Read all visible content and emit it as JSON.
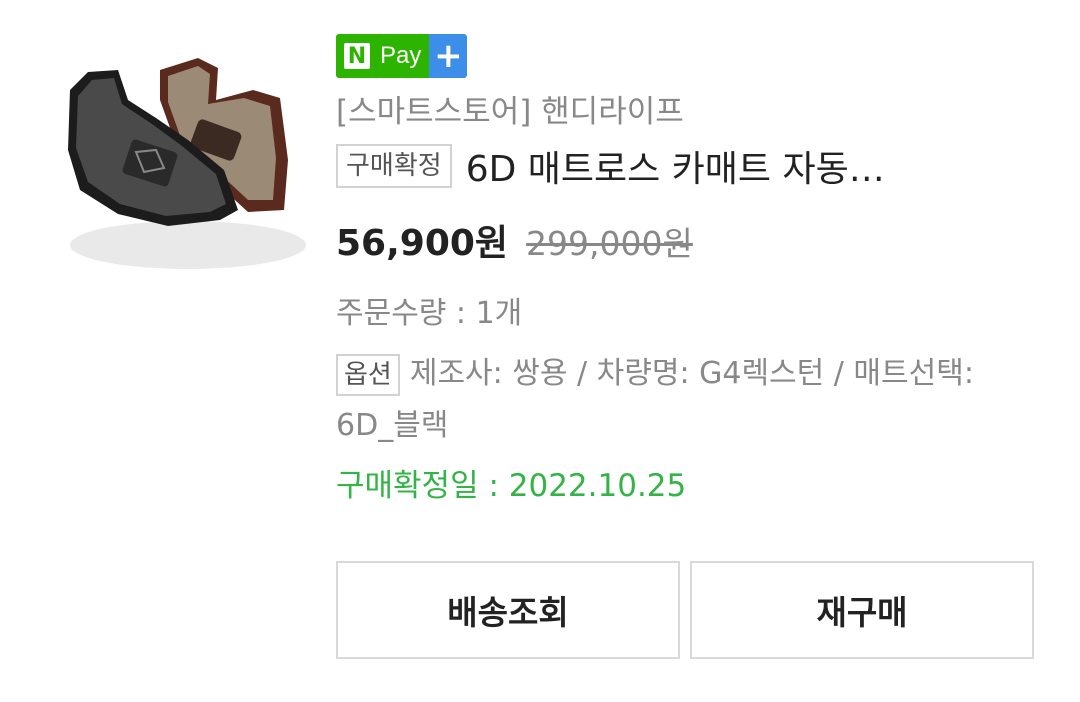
{
  "product": {
    "image_alt": "car floor mat thumbnail",
    "badge": {
      "n": "N",
      "pay": "Pay",
      "plus": "+"
    },
    "store": "[스마트스토어] 핸디라이프",
    "status_tag": "구매확정",
    "title": "6D 매트로스 카매트 자동…",
    "price": "56,900원",
    "original_price": "299,000원",
    "quantity": "주문수량 : 1개",
    "option_tag": "옵션",
    "option_text": "제조사: 쌍용 / 차량명: G4렉스턴 / 매트선택: 6D_블랙",
    "confirm_date": "구매확정일 : 2022.10.25"
  },
  "actions": {
    "track_label": "배송조회",
    "rebuy_label": "재구매"
  },
  "colors": {
    "npay_green": "#2db400",
    "npay_blue": "#3d8ee8",
    "confirm_green": "#34b447"
  }
}
